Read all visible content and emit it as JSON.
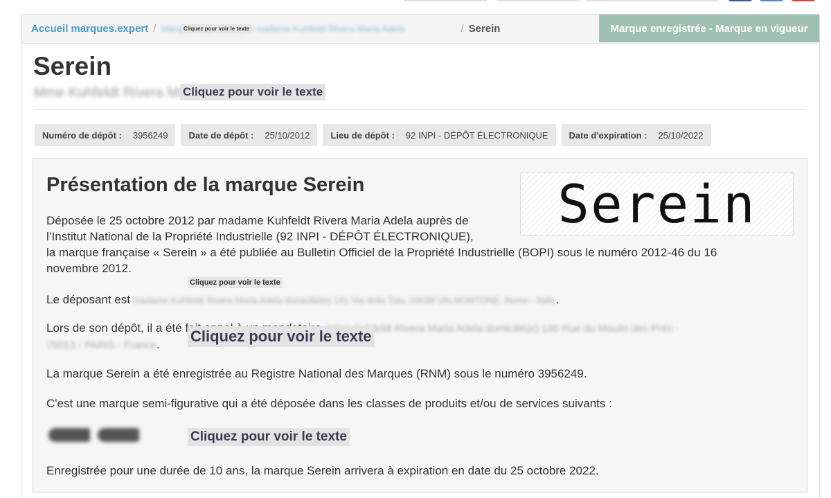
{
  "breadcrumb": {
    "home_label": "Accueil marques.expert",
    "separator": "/",
    "hidden_crumb_text": "Marques déposées par madame Kuhfeldt Rivera Maria Adela",
    "current": "Serein"
  },
  "reveal_label": "Cliquez pour voir le texte",
  "status_badge": "Marque enregistrée - Marque en vigueur",
  "title": "Serein",
  "owner_hidden": "Mme Kuhfeldt Rivera Maria Adela",
  "meta": [
    {
      "key": "Numéro de dépôt :",
      "value": "3956249"
    },
    {
      "key": "Date de dépôt :",
      "value": "25/10/2012"
    },
    {
      "key": "Lieu de dépôt :",
      "value": "92 INPI - DÉPÔT ÉLECTRONIQUE"
    },
    {
      "key": "Date d'expiration :",
      "value": "25/10/2022"
    }
  ],
  "presentation": {
    "heading": "Présentation de la marque Serein",
    "logo_text": "Serein",
    "p1_line1": "Déposée le 25 octobre 2012 par madame Kuhfeldt Rivera Maria Adela auprès de",
    "p1_line2": "l’Institut National de la Propriété Industrielle (92 INPI - DÉPÔT ÉLECTRONIQUE),",
    "p1_line3": "la marque française « Serein » a été publiée au Bulletin Officiel de la Propriété Industrielle (BOPI) sous le numéro 2012-46 du 16",
    "p1_line4": "novembre 2012.",
    "p2_prefix": "Le déposant est",
    "p2_hidden": "madame Kuhfeldt Rivera Maria Adela domicilié(e) 141 Via della Tota, 00038 VALMONTONE, Rome - Italie",
    "p2_suffix": ".",
    "p3_prefix": "Lors de son dépôt, il a été fait appel à un mandataire,",
    "p3_hidden_line1": "Mme Kuhfeldt Rivera Maria Adela domicilié(e) 100 Rue du Moulin des Prés -",
    "p3_hidden_line2": "75013 - PARIS - France",
    "p3_suffix": ".",
    "p4": "La marque Serein a été enregistrée au Registre National des Marques (RNM) sous le numéro 3956249.",
    "p5": "C'est une marque semi-figurative qui a été déposée dans les classes de produits et/ou de services suivants :",
    "p6": "Enregistrée pour une durée de 10 ans, la marque Serein arrivera à expiration en date du 25 octobre 2022."
  },
  "colors": {
    "link": "#4a9ac9",
    "badge_bg": "#9fc0b3",
    "chip_bg": "#e8e8e8",
    "card_bg": "#f6f6f6"
  }
}
